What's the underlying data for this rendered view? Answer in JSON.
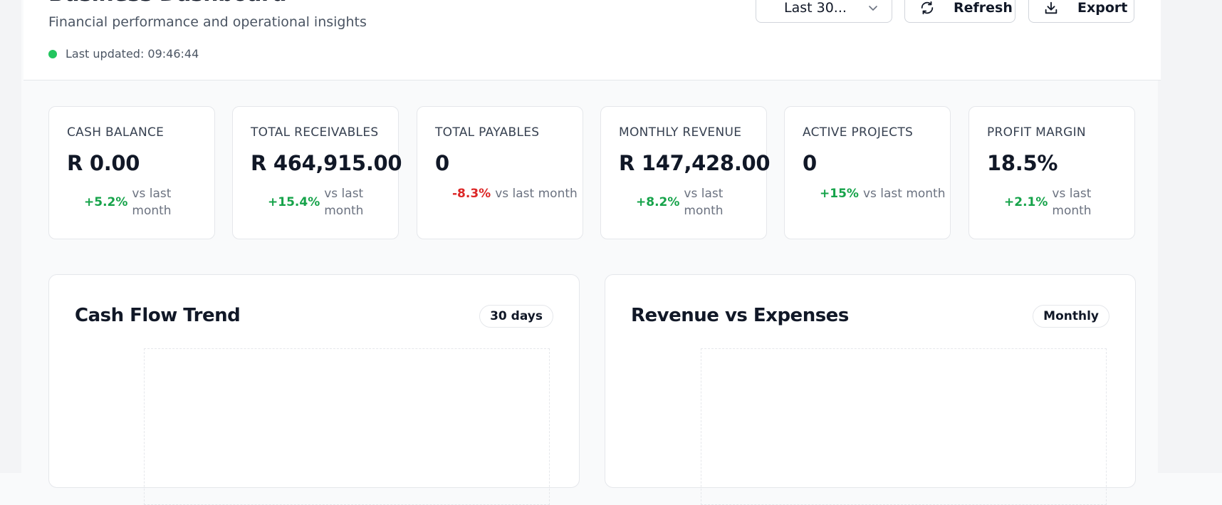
{
  "header": {
    "title": "Business Dashboard",
    "subtitle": "Financial performance and operational insights",
    "last_updated": "Last updated: 09:46:44",
    "date_range": "Last 30...",
    "refresh_label": "Refresh",
    "export_label": "Export",
    "status_color": "#22c55e"
  },
  "kpis": [
    {
      "label": "CASH BALANCE",
      "value": "R 0.00",
      "change": "+5.2%",
      "trend": "up",
      "suffix": "vs last month"
    },
    {
      "label": "TOTAL RECEIVABLES",
      "value": "R 464,915.00",
      "change": "+15.4%",
      "trend": "up",
      "suffix": "vs last month"
    },
    {
      "label": "TOTAL PAYABLES",
      "value": "0",
      "change": "-8.3%",
      "trend": "down",
      "suffix": "vs last month"
    },
    {
      "label": "MONTHLY REVENUE",
      "value": "R 147,428.00",
      "change": "+8.2%",
      "trend": "up",
      "suffix": "vs last month"
    },
    {
      "label": "ACTIVE PROJECTS",
      "value": "0",
      "change": "+15%",
      "trend": "up",
      "suffix": "vs last month"
    },
    {
      "label": "PROFIT MARGIN",
      "value": "18.5%",
      "change": "+2.1%",
      "trend": "up",
      "suffix": "vs last month"
    }
  ],
  "charts": {
    "cash_flow": {
      "title": "Cash Flow Trend",
      "badge": "30 days"
    },
    "revenue_expenses": {
      "title": "Revenue vs Expenses",
      "badge": "Monthly"
    }
  },
  "colors": {
    "positive": "#16a34a",
    "negative": "#dc2626"
  }
}
